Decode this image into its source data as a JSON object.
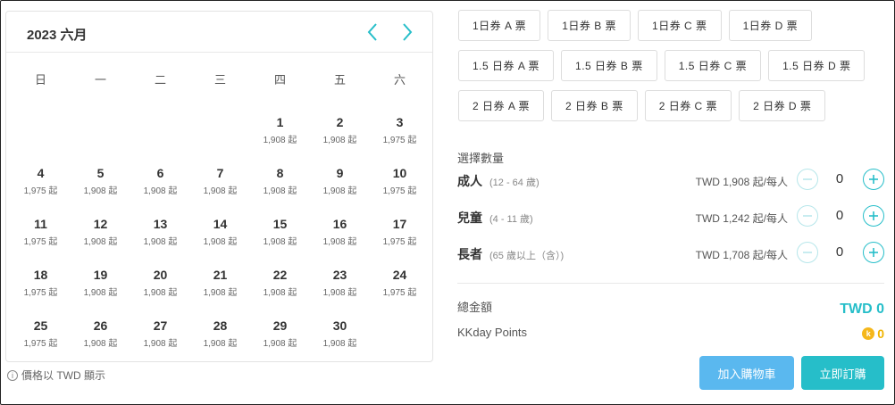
{
  "calendar": {
    "title": "2023 六月",
    "prev_icon": "chevron-left-icon",
    "next_icon": "chevron-right-icon",
    "weekdays": [
      "日",
      "一",
      "二",
      "三",
      "四",
      "五",
      "六"
    ],
    "leading_blanks": 4,
    "days": [
      {
        "num": "1",
        "price": "1,908 起"
      },
      {
        "num": "2",
        "price": "1,908 起"
      },
      {
        "num": "3",
        "price": "1,975 起"
      },
      {
        "num": "4",
        "price": "1,975 起"
      },
      {
        "num": "5",
        "price": "1,908 起"
      },
      {
        "num": "6",
        "price": "1,908 起"
      },
      {
        "num": "7",
        "price": "1,908 起"
      },
      {
        "num": "8",
        "price": "1,908 起"
      },
      {
        "num": "9",
        "price": "1,908 起"
      },
      {
        "num": "10",
        "price": "1,975 起"
      },
      {
        "num": "11",
        "price": "1,975 起"
      },
      {
        "num": "12",
        "price": "1,908 起"
      },
      {
        "num": "13",
        "price": "1,908 起"
      },
      {
        "num": "14",
        "price": "1,908 起"
      },
      {
        "num": "15",
        "price": "1,908 起"
      },
      {
        "num": "16",
        "price": "1,908 起"
      },
      {
        "num": "17",
        "price": "1,975 起"
      },
      {
        "num": "18",
        "price": "1,975 起"
      },
      {
        "num": "19",
        "price": "1,908 起"
      },
      {
        "num": "20",
        "price": "1,908 起"
      },
      {
        "num": "21",
        "price": "1,908 起"
      },
      {
        "num": "22",
        "price": "1,908 起"
      },
      {
        "num": "23",
        "price": "1,908 起"
      },
      {
        "num": "24",
        "price": "1,975 起"
      },
      {
        "num": "25",
        "price": "1,975 起"
      },
      {
        "num": "26",
        "price": "1,908 起"
      },
      {
        "num": "27",
        "price": "1,908 起"
      },
      {
        "num": "28",
        "price": "1,908 起"
      },
      {
        "num": "29",
        "price": "1,908 起"
      },
      {
        "num": "30",
        "price": "1,908 起"
      }
    ],
    "note": "價格以 TWD 顯示"
  },
  "tickets": {
    "row1": [
      "1日券 A 票",
      "1日券 B 票",
      "1日券 C 票",
      "1日券 D 票"
    ],
    "row2": [
      "1.5 日券 A 票",
      "1.5 日券 B 票",
      "1.5 日券 C 票",
      "1.5 日券 D 票"
    ],
    "row3": [
      "2 日券 A 票",
      "2 日券 B 票",
      "2 日券 C 票",
      "2 日券 D 票"
    ]
  },
  "quantity": {
    "title": "選擇數量",
    "rows": [
      {
        "label": "成人",
        "sub": "(12 - 64 歲)",
        "price": "TWD 1,908 起/每人",
        "count": "0"
      },
      {
        "label": "兒童",
        "sub": "(4 - 11 歲)",
        "price": "TWD 1,242 起/每人",
        "count": "0"
      },
      {
        "label": "長者",
        "sub": "(65 歲以上（含）)",
        "price": "TWD 1,708 起/每人",
        "count": "0"
      }
    ]
  },
  "summary": {
    "total_label": "總金額",
    "total_value": "TWD 0",
    "points_label": "KKday Points",
    "points_value": "0",
    "coin_letter": "k"
  },
  "actions": {
    "cart_label": "加入購物車",
    "buy_label": "立即訂購"
  },
  "colors": {
    "accent": "#26bec9",
    "cart_button": "#5ab8ef",
    "points": "#f0b400"
  }
}
